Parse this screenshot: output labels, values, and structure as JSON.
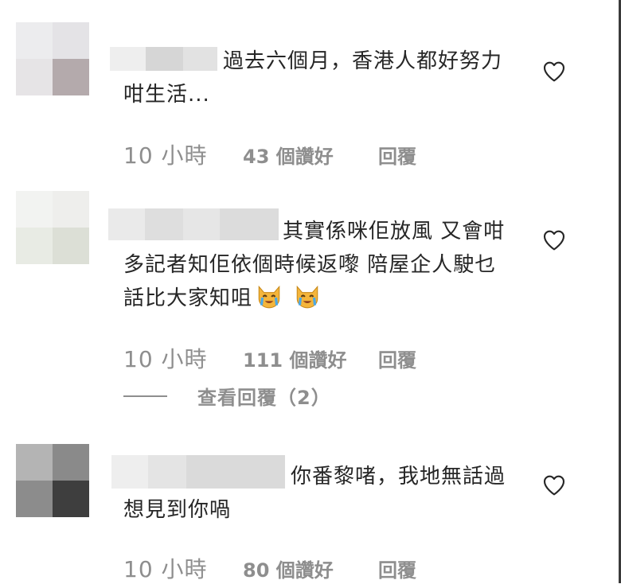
{
  "comments": [
    {
      "text": "過去六個月，香港人都好努力咁生活...",
      "time": "10 小時",
      "likes": "43 個讚好",
      "reply_label": "回覆",
      "avatar_colors": [
        "#ececee",
        "#e4e3e6",
        "#e6e4e6",
        "#b4aaac"
      ],
      "name_blur_colors": [
        "#eeeeee",
        "#d6d6d6",
        "#e2e2e2"
      ]
    },
    {
      "text": "其實係咪佢放風 又會咁多記者知佢依個時候返嚟 陪屋企人駛乜話比大家知咀",
      "emojis": [
        "crying-cat-icon",
        "crying-cat-icon"
      ],
      "time": "10 小時",
      "likes": "111 個讚好",
      "reply_label": "回覆",
      "view_replies": "查看回覆（2）",
      "avatar_colors": [
        "#f2f3f1",
        "#eeeeec",
        "#e8ebe4",
        "#dcdfd6"
      ],
      "name_blur_colors": [
        "#eaeaea",
        "#dedede",
        "#e6e6e6",
        "#dcdcdc"
      ]
    },
    {
      "text": "你番黎啫，我地無話過想見到你喎",
      "time": "10 小時",
      "likes": "80 個讚好",
      "reply_label": "回覆",
      "avatar_colors": [
        "#b4b4b4",
        "#8a8a8a",
        "#8c8c8c",
        "#3e3e3e"
      ],
      "name_blur_colors": [
        "#eeeeee",
        "#e4e4e4",
        "#dadada"
      ]
    }
  ]
}
